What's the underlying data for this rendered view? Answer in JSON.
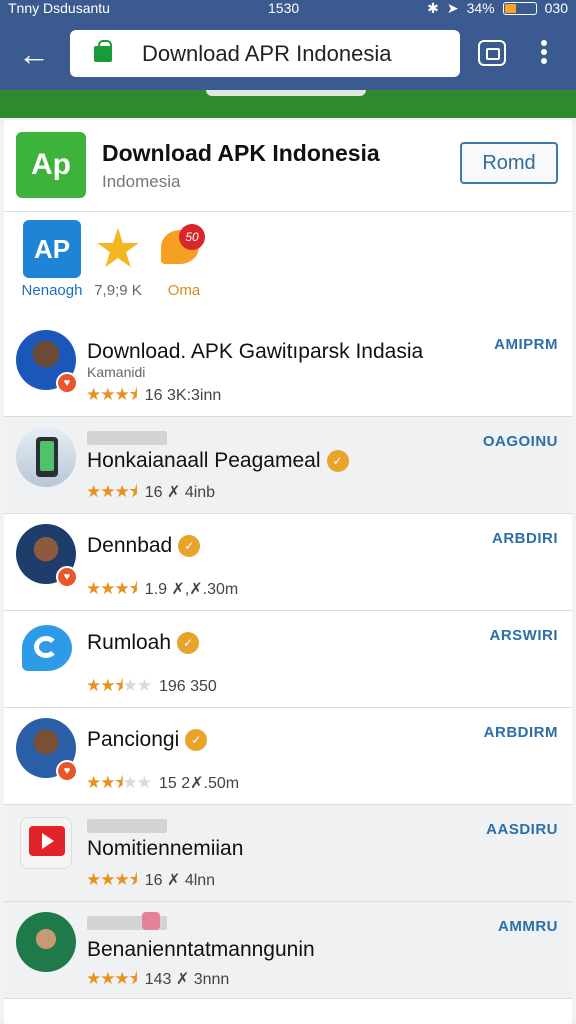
{
  "status_bar": {
    "carrier": "Tnny Dsdusantu",
    "time": "1530",
    "battery": "34%",
    "extra": "030",
    "battery_level": 0.34
  },
  "toolbar": {
    "url": "Download APR Indonesia",
    "back_icon": "arrow-left-icon",
    "lock_icon": "lock-icon",
    "tabs_icon": "tabs-icon",
    "menu_icon": "more-vert-icon"
  },
  "header": {
    "logo_text": "Ap",
    "title": "Download APK Indonesia",
    "subtitle": "Indomesia",
    "button_label": "Romd"
  },
  "quick": [
    {
      "icon": "ap-app-icon",
      "glyph": "AP",
      "label": "Nenaogh",
      "label_color": "#1f6fbf"
    },
    {
      "icon": "star-icon",
      "glyph": "★",
      "label": "7,9;9 K",
      "label_color": "#666666"
    },
    {
      "icon": "chat-badge-icon",
      "glyph": "50",
      "label": "Oma",
      "label_color": "#e08a1a"
    }
  ],
  "list": [
    {
      "title": "Download. APK Gawitıparsk Indasia",
      "subtitle": "Kamanidi",
      "stars_full": 3,
      "stars_half": true,
      "stars_empty": 1,
      "rating": "16 3K:3inn",
      "action": "AMIPRM"
    },
    {
      "title": "Honkaianaall Peagameal",
      "subtitle": "",
      "stars_full": 3,
      "stars_half": true,
      "stars_empty": 1,
      "rating": "16 ✗ 4inb",
      "action": "OAGOINU"
    },
    {
      "title": "Dennbad",
      "subtitle": "",
      "stars_full": 3,
      "stars_half": true,
      "stars_empty": 1,
      "rating": "1.9 ✗,✗.30m",
      "action": "ARBDIRI"
    },
    {
      "title": "Rumloah",
      "subtitle": "",
      "stars_full": 2,
      "stars_half": true,
      "stars_empty": 2,
      "rating": "196 350",
      "action": "ARSWIRI"
    },
    {
      "title": "Panciongi",
      "subtitle": "",
      "stars_full": 2,
      "stars_half": true,
      "stars_empty": 2,
      "rating": "15 2✗.50m",
      "action": "ARBDIRM"
    },
    {
      "title": "Nomitiennemiian",
      "subtitle": "",
      "stars_full": 3,
      "stars_half": true,
      "stars_empty": 1,
      "rating": "16 ✗ 4lnn",
      "action": "AASDIRU"
    },
    {
      "title": "Benanienntatmanngunin",
      "subtitle": "",
      "stars_full": 3,
      "stars_half": true,
      "stars_empty": 1,
      "rating": "143 ✗ 3nnn",
      "action": "AMMRU"
    }
  ],
  "colors": {
    "brand_bar": "#3b5a8f",
    "green_strip": "#2e8a2e",
    "action_text": "#2c6ea8",
    "star": "#e8911d"
  }
}
